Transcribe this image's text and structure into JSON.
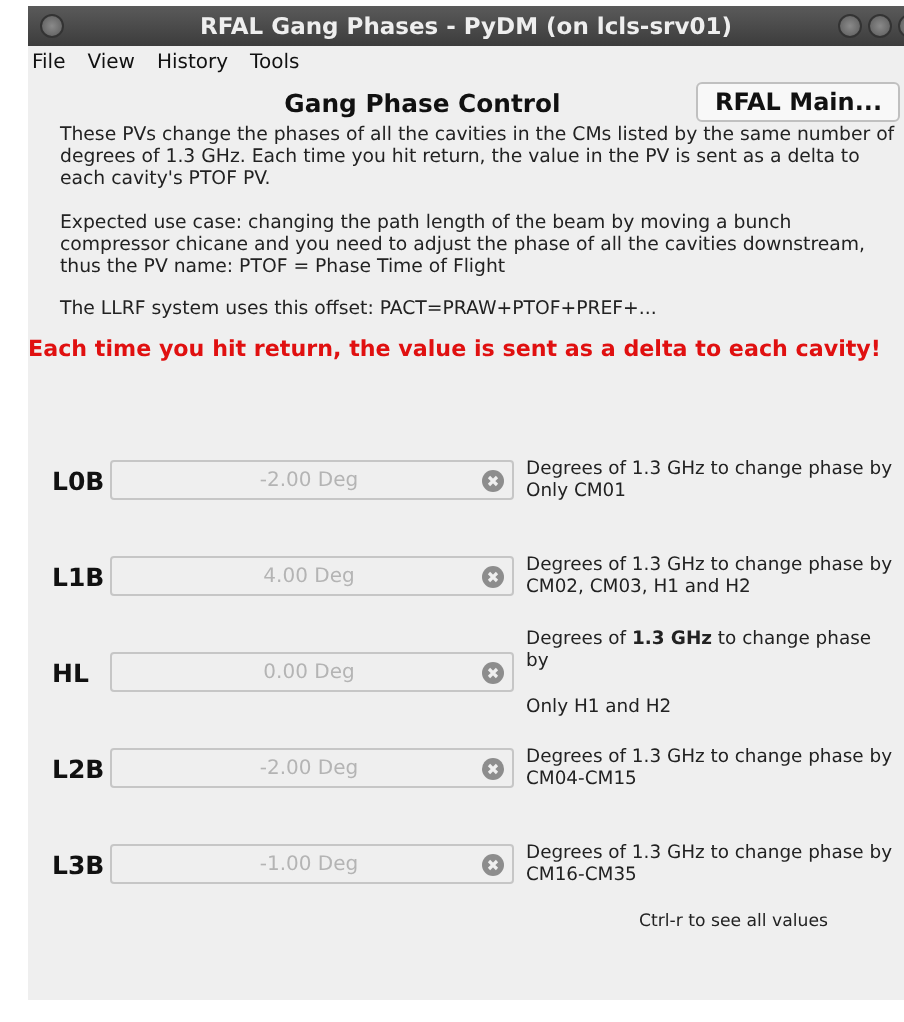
{
  "window": {
    "title": "RFAL Gang Phases - PyDM (on lcls-srv01)"
  },
  "menu": [
    "File",
    "View",
    "History",
    "Tools"
  ],
  "heading": "Gang Phase Control",
  "main_button": "RFAL Main...",
  "paragraphs": [
    "These PVs change the phases of all the cavities in the CMs listed by the same number of degrees of 1.3 GHz. Each time you hit return, the value in the PV is sent as a delta to each cavity's PTOF PV.",
    "Expected use case: changing the path length of the beam by moving a bunch compressor chicane and you need to adjust the phase of all the cavities downstream, thus the PV name: PTOF = Phase Time of Flight",
    "The LLRF system uses this offset: PACT=PRAW+PTOF+PREF+..."
  ],
  "warning": "Each time you hit return, the value is sent as a delta to each cavity!",
  "rows": [
    {
      "label": "L0B",
      "value": "-2.00 Deg",
      "disabled": true,
      "description": "Degrees of 1.3 GHz to change phase by Only CM01"
    },
    {
      "label": "L1B",
      "value": "4.00 Deg",
      "disabled": true,
      "description": "Degrees of 1.3 GHz to change phase by CM02, CM03, H1 and H2"
    },
    {
      "label": "HL",
      "value": "0.00 Deg",
      "disabled": true,
      "description": "Degrees of **1.3 GHz** to change phase by",
      "note": "Only H1 and H2"
    },
    {
      "label": "L2B",
      "value": "-2.00 Deg",
      "disabled": true,
      "description": "Degrees of 1.3 GHz to change phase by CM04-CM15"
    },
    {
      "label": "L3B",
      "value": "-1.00 Deg",
      "disabled": true,
      "description": "Degrees of 1.3 GHz to change phase by CM16-CM35"
    }
  ],
  "hint": "Ctrl-r to see all values"
}
